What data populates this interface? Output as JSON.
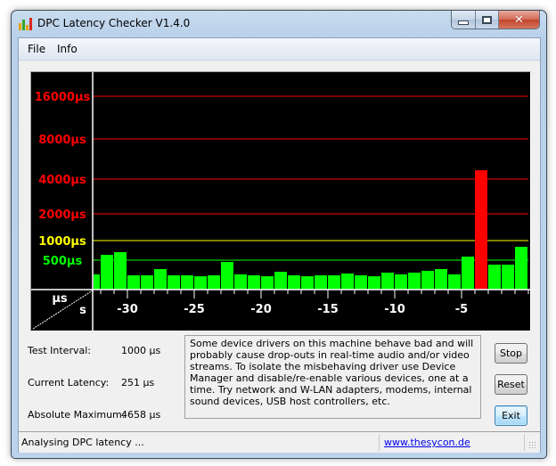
{
  "window": {
    "title": "DPC Latency Checker V1.4.0",
    "icon": "bar-chart-app-icon",
    "controls": {
      "minimize": "minimize-icon",
      "maximize": "maximize-icon",
      "close": "close-icon",
      "close_glyph": "✕"
    }
  },
  "menu": [
    {
      "label": "File"
    },
    {
      "label": "Info"
    }
  ],
  "info": {
    "test_interval": {
      "label": "Test Interval:",
      "value": "1000 µs"
    },
    "current_latency": {
      "label": "Current Latency:",
      "value": "251 µs"
    },
    "absolute_maximum": {
      "label": "Absolute Maximum:",
      "value": "4658 µs"
    }
  },
  "message": "Some device drivers on this machine behave bad and will probably cause drop-outs in real-time audio and/or video streams. To isolate the misbehaving driver use Device Manager and disable/re-enable various devices, one at a time. Try network and W-LAN adapters, modems, internal sound devices, USB host controllers, etc.",
  "buttons": {
    "stop": "Stop",
    "reset": "Reset",
    "exit": "Exit"
  },
  "status": {
    "text": "Analysing DPC latency ...",
    "link": "www.thesycon.de"
  },
  "colors": {
    "ok": "#00ff00",
    "warn": "#ffff00",
    "bad": "#ff0000",
    "background": "#000000",
    "axis": "#ffffff"
  },
  "chart_data": {
    "type": "bar",
    "title": "",
    "xlabel": "s",
    "ylabel": "µs",
    "y_scale": "log",
    "ylim": [
      250,
      20000
    ],
    "xlim": [
      -33,
      0
    ],
    "x_tick_labels": [
      "-30",
      "-25",
      "-20",
      "-15",
      "-10",
      "-5"
    ],
    "x_ticks": [
      -30,
      -25,
      -20,
      -15,
      -10,
      -5
    ],
    "gridlines": [
      {
        "value": 16000,
        "label": "16000µs",
        "color": "#ff0000"
      },
      {
        "value": 8000,
        "label": "8000µs",
        "color": "#ff0000"
      },
      {
        "value": 4000,
        "label": "4000µs",
        "color": "#ff0000"
      },
      {
        "value": 2000,
        "label": "2000µs",
        "color": "#ff0000"
      },
      {
        "value": 1000,
        "label": "1000µs",
        "color": "#ffff00"
      },
      {
        "value": 500,
        "label": "500µs",
        "color": "#00ff00"
      }
    ],
    "thresholds": {
      "ok_below": 1000,
      "warn_below": 2000
    },
    "x": [
      -32.5,
      -31.5,
      -30.5,
      -29.5,
      -28.5,
      -27.5,
      -26.5,
      -25.5,
      -24.5,
      -23.5,
      -22.5,
      -21.5,
      -20.5,
      -19.5,
      -18.5,
      -17.5,
      -16.5,
      -15.5,
      -14.5,
      -13.5,
      -12.5,
      -11.5,
      -10.5,
      -9.5,
      -8.5,
      -7.5,
      -6.5,
      -5.5,
      -4.5,
      -3.5,
      -2.5,
      -1.5,
      -0.5
    ],
    "values": [
      303,
      604,
      664,
      293,
      293,
      365,
      293,
      293,
      283,
      293,
      469,
      303,
      293,
      283,
      332,
      293,
      283,
      293,
      293,
      312,
      293,
      283,
      322,
      303,
      322,
      343,
      365,
      303,
      567,
      4658,
      427,
      427,
      802
    ]
  }
}
